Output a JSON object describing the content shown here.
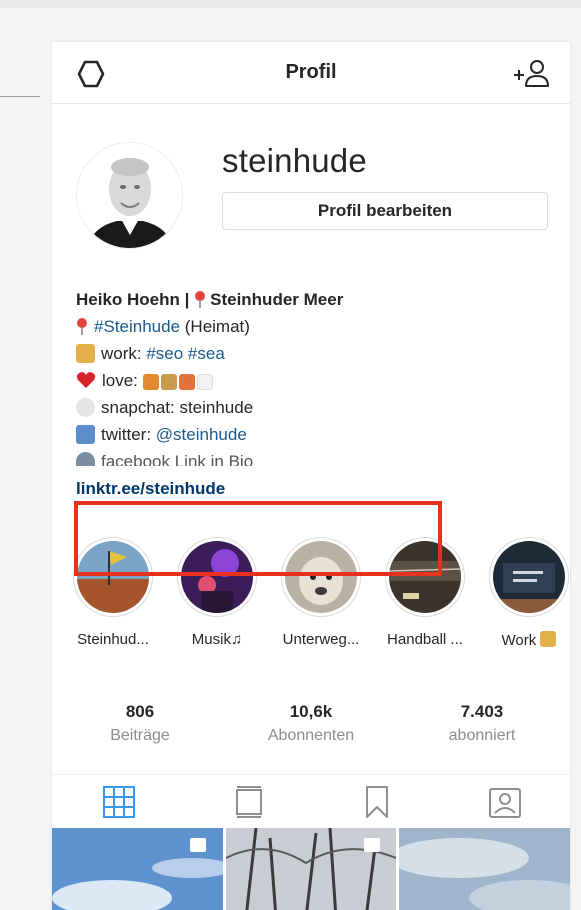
{
  "header": {
    "title": "Profil",
    "left_icon": "gear-icon",
    "right_icon": "add-user-icon"
  },
  "profile": {
    "username": "steinhude",
    "edit_button": "Profil bearbeiten"
  },
  "bio": {
    "name": "Heiko Hoehn | ",
    "location": "Steinhuder Meer",
    "line_hashtag": "#Steinhude",
    "line_hashtag_suffix": " (Heimat)",
    "work_prefix": "work: ",
    "work_tags": "#seo #sea",
    "love": "love: ",
    "snapchat": "snapchat: steinhude",
    "twitter_prefix": "twitter: ",
    "twitter_handle": "@steinhude",
    "facebook": "facebook Link in Bio",
    "url": "linktr.ee/steinhude"
  },
  "highlights": [
    {
      "label": "Steinhud..."
    },
    {
      "label": "Musik♫"
    },
    {
      "label": "Unterweg..."
    },
    {
      "label": "Handball ..."
    },
    {
      "label": "Work"
    }
  ],
  "stats": [
    {
      "value": "806",
      "label": "Beiträge"
    },
    {
      "value": "10,6k",
      "label": "Abonnenten"
    },
    {
      "value": "7.403",
      "label": "abonniert"
    }
  ],
  "tabs": [
    "grid-icon",
    "feed-icon",
    "bookmark-icon",
    "tagged-icon"
  ],
  "colors": {
    "accent_blue": "#3897f0",
    "link_blue": "#00376b",
    "annotation_red": "#e8301f"
  }
}
